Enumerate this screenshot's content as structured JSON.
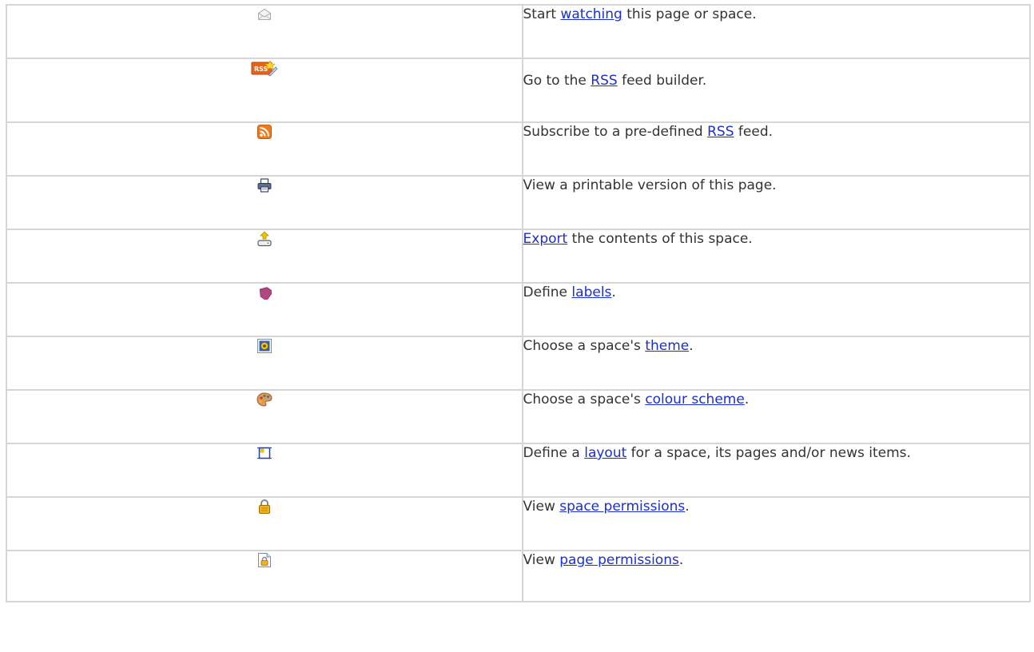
{
  "rows": [
    {
      "icon": "envelope-icon",
      "before": "Start ",
      "link": "watching",
      "after": " this page or space."
    },
    {
      "icon": "rss-feed-builder-icon",
      "icon_text": "RSS",
      "before": "Go to the ",
      "link": "RSS",
      "after": " feed builder."
    },
    {
      "icon": "rss-feed-icon",
      "before": "Subscribe to a pre-defined ",
      "link": "RSS",
      "after": " feed."
    },
    {
      "icon": "printer-icon",
      "before": "View a printable version of this page.",
      "link": "",
      "after": ""
    },
    {
      "icon": "export-icon",
      "before": "",
      "link": "Export",
      "after": " the contents of this space."
    },
    {
      "icon": "label-icon",
      "before": "Define ",
      "link": "labels",
      "after": "."
    },
    {
      "icon": "theme-icon",
      "before": "Choose a space's ",
      "link": "theme",
      "after": "."
    },
    {
      "icon": "palette-icon",
      "before": "Choose a space's ",
      "link": "colour scheme",
      "after": "."
    },
    {
      "icon": "layout-icon",
      "before": "Define a ",
      "link": "layout",
      "after": " for a space, its pages and/or news items."
    },
    {
      "icon": "padlock-icon",
      "before": "View ",
      "link": "space permissions",
      "after": "."
    },
    {
      "icon": "page-lock-icon",
      "before": "View ",
      "link": "page permissions",
      "after": "."
    }
  ],
  "colors": {
    "link": "#1b2fd0",
    "text": "#333333",
    "border": "#d6d6d6",
    "rss_orange": "#f07a1e",
    "label_pink": "#b2477f",
    "layout_blue": "#1f3fa8",
    "layout_yellow": "#f2c200"
  }
}
